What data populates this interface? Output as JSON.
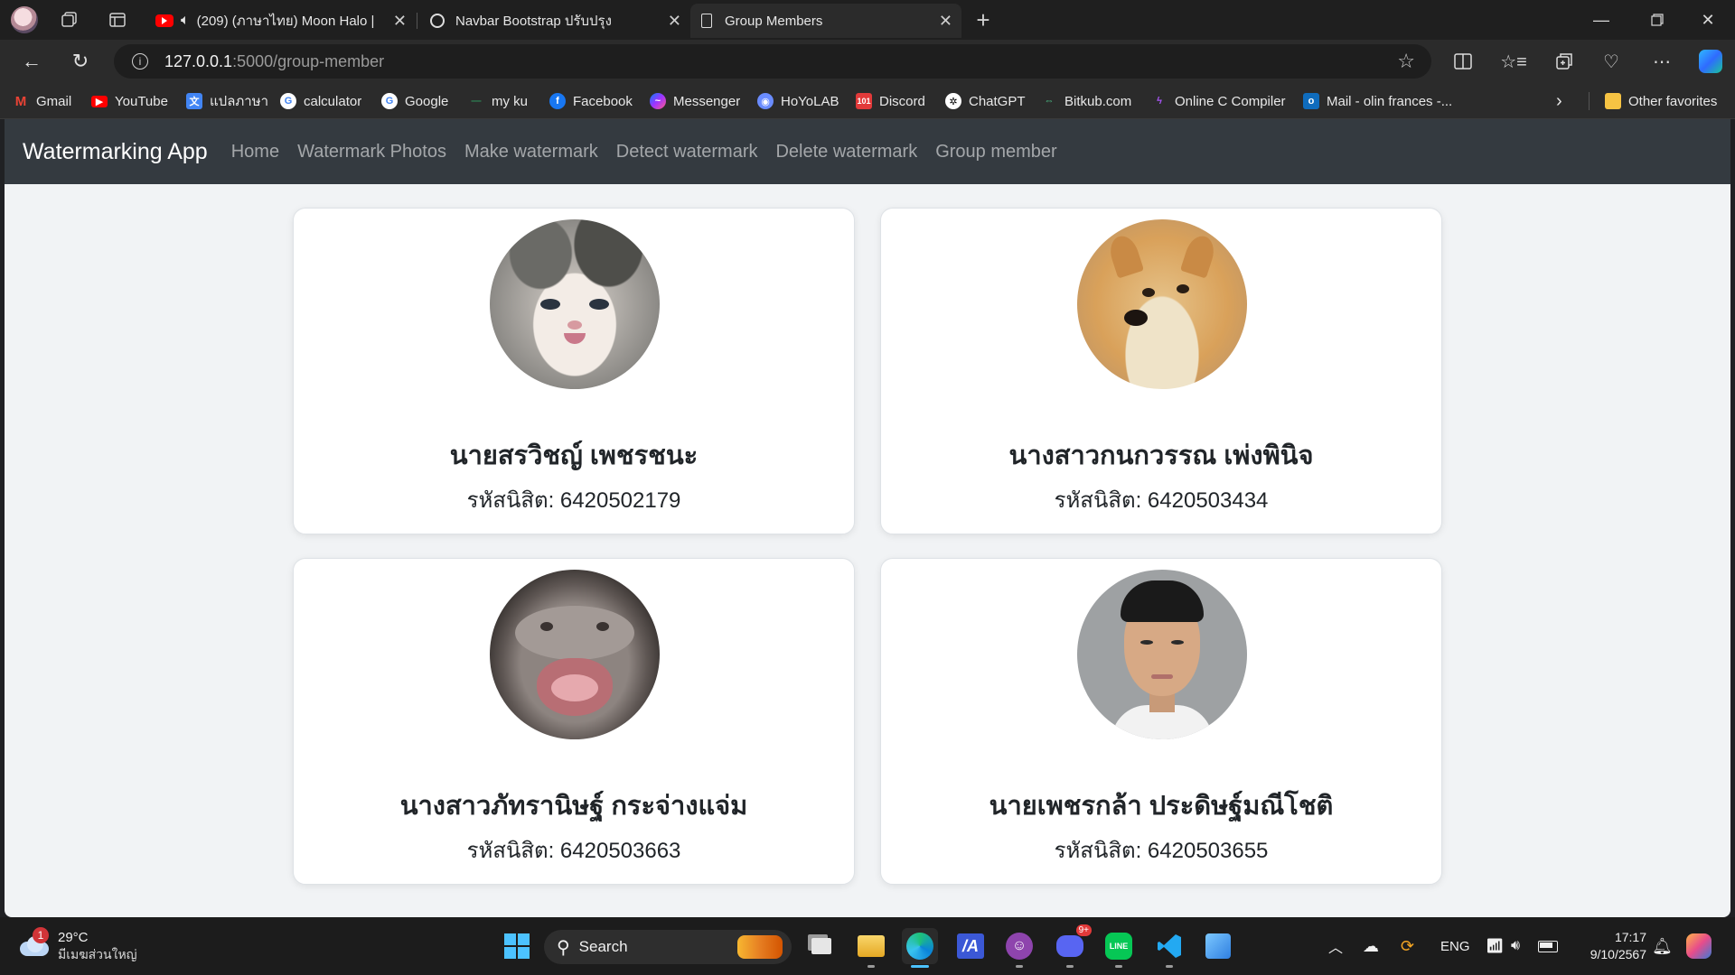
{
  "browser": {
    "tabs": [
      {
        "label": "(209) (ภาษาไทย) Moon Halo |",
        "muted_icon": "speaker-icon"
      },
      {
        "label": "Navbar Bootstrap ปรับปรุง"
      },
      {
        "label": "Group Members"
      }
    ],
    "url_host": "127.0.0.1",
    "url_path": ":5000/group-member",
    "favorites": [
      "Gmail",
      "YouTube",
      "แปลภาษา",
      "calculator",
      "Google",
      "my ku",
      "Facebook",
      "Messenger",
      "HoYoLAB",
      "Discord",
      "ChatGPT",
      "Bitkub.com",
      "Online C Compiler",
      "Mail - olin frances -..."
    ],
    "other_favorites": "Other favorites"
  },
  "app": {
    "brand": "Watermarking App",
    "nav": [
      "Home",
      "Watermark Photos",
      "Make watermark",
      "Detect watermark",
      "Delete watermark",
      "Group member"
    ]
  },
  "members": [
    {
      "name": "นายสรวิชญ์ เพชรชนะ",
      "id_line": "รหัสนิสิต: 6420502179",
      "photo": "kitten-photo"
    },
    {
      "name": "นางสาวกนกวรรณ เพ่งพินิจ",
      "id_line": "รหัสนิสิต: 6420503434",
      "photo": "shiba-doge-photo"
    },
    {
      "name": "นางสาวภัทรานิษฐ์ กระจ่างแจ่ม",
      "id_line": "รหัสนิสิต: 6420503663",
      "photo": "baby-hippo-photo"
    },
    {
      "name": "นายเพชรกล้า ประดิษฐ์มณีโชติ",
      "id_line": "รหัสนิสิต: 6420503655",
      "photo": "student-portrait-photo"
    }
  ],
  "taskbar": {
    "weather_badge": "1",
    "temperature": "29°C",
    "weather_text": "มีเมฆส่วนใหญ่",
    "search_label": "Search",
    "language": "ENG",
    "time": "17:17",
    "date": "9/10/2567",
    "discord_badge": "9+"
  }
}
